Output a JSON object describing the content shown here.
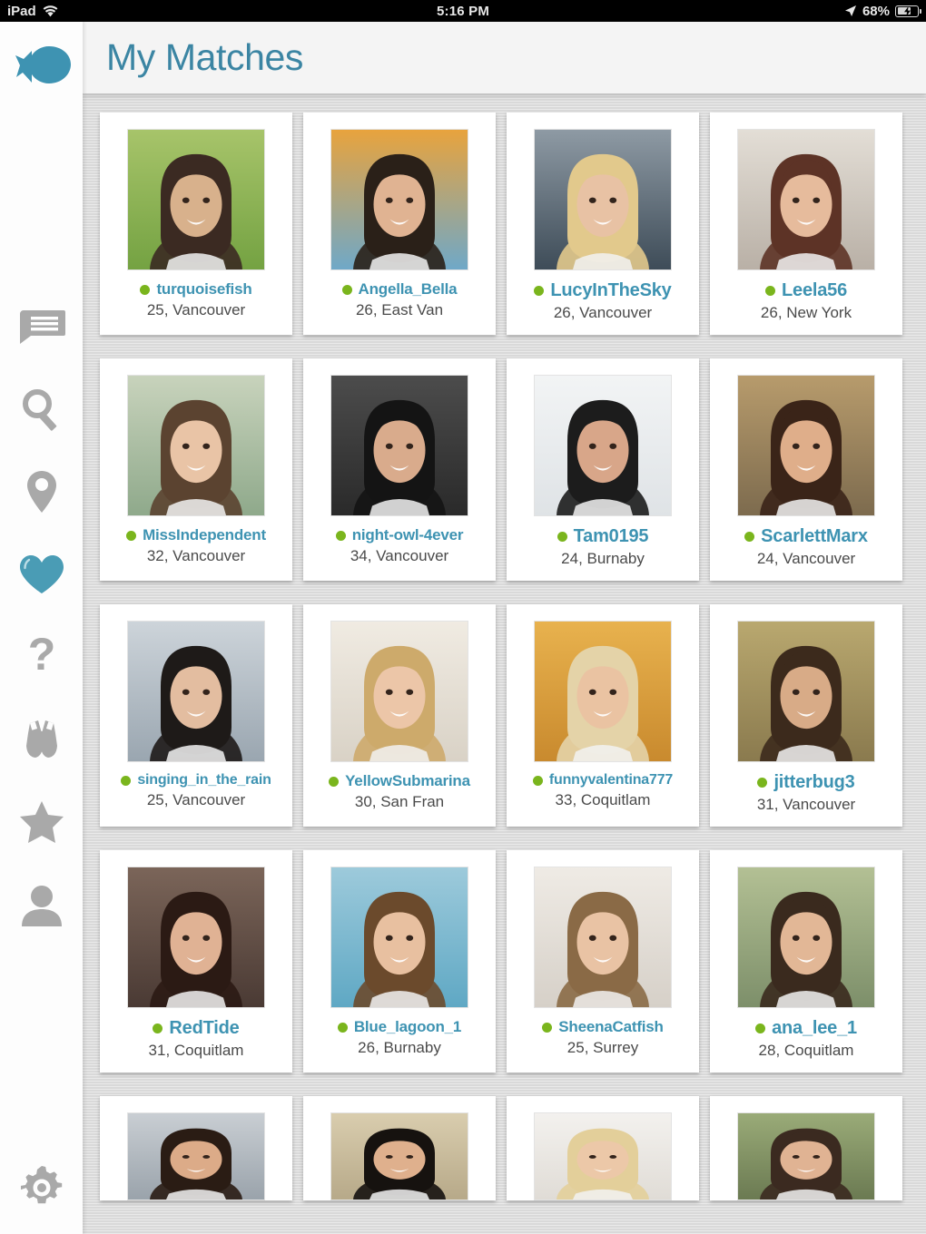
{
  "statusbar": {
    "device": "iPad",
    "wifi_icon": "wifi-icon",
    "time": "5:16 PM",
    "location_icon": "location-arrow-icon",
    "battery_percent": "68%",
    "battery_icon": "battery-charging-icon"
  },
  "brand": {
    "logo_icon": "fish-logo-icon",
    "teal": "#3e93b2",
    "green": "#7ab51d",
    "header_bg": "#f4f4f4"
  },
  "header": {
    "title": "My Matches"
  },
  "sidebar": {
    "items": [
      {
        "name": "messages",
        "icon": "message-bubble-icon",
        "active": false
      },
      {
        "name": "search",
        "icon": "search-icon",
        "active": false
      },
      {
        "name": "nearby",
        "icon": "location-pin-icon",
        "active": false
      },
      {
        "name": "matches",
        "icon": "heart-icon",
        "active": true
      },
      {
        "name": "help",
        "icon": "question-mark-icon",
        "active": false
      },
      {
        "name": "viewed",
        "icon": "binoculars-icon",
        "active": false
      },
      {
        "name": "favourites",
        "icon": "star-icon",
        "active": false
      },
      {
        "name": "profile",
        "icon": "person-icon",
        "active": false
      }
    ],
    "settings": {
      "name": "settings",
      "icon": "gear-icon"
    }
  },
  "matches": [
    {
      "username": "turquoisefish",
      "meta": "25, Vancouver",
      "online": true,
      "photo": "p1"
    },
    {
      "username": "Angella_Bella",
      "meta": "26, East Van",
      "online": true,
      "photo": "p2"
    },
    {
      "username": "LucyInTheSky",
      "meta": "26, Vancouver",
      "online": true,
      "photo": "p3"
    },
    {
      "username": "Leela56",
      "meta": "26, New York",
      "online": true,
      "photo": "p4"
    },
    {
      "username": "MissIndependent",
      "meta": "32, Vancouver",
      "online": true,
      "photo": "p5"
    },
    {
      "username": "night-owl-4ever",
      "meta": "34, Vancouver",
      "online": true,
      "photo": "p6"
    },
    {
      "username": "Tam0195",
      "meta": "24, Burnaby",
      "online": true,
      "photo": "p7"
    },
    {
      "username": "ScarlettMarx",
      "meta": "24, Vancouver",
      "online": true,
      "photo": "p8"
    },
    {
      "username": "singing_in_the_rain",
      "meta": "25, Vancouver",
      "online": true,
      "photo": "p9"
    },
    {
      "username": "YellowSubmarina",
      "meta": "30, San Fran",
      "online": true,
      "photo": "p10"
    },
    {
      "username": "funnyvalentina777",
      "meta": "33, Coquitlam",
      "online": true,
      "photo": "p11"
    },
    {
      "username": "jitterbug3",
      "meta": "31, Vancouver",
      "online": true,
      "photo": "p12"
    },
    {
      "username": "RedTide",
      "meta": "31, Coquitlam",
      "online": true,
      "photo": "p13"
    },
    {
      "username": "Blue_lagoon_1",
      "meta": "26, Burnaby",
      "online": true,
      "photo": "p14"
    },
    {
      "username": "SheenaCatfish",
      "meta": "25, Surrey",
      "online": true,
      "photo": "p15"
    },
    {
      "username": "ana_lee_1",
      "meta": "28, Coquitlam",
      "online": true,
      "photo": "p16"
    },
    {
      "username": "",
      "meta": "",
      "online": false,
      "photo": "p17",
      "partial": true
    },
    {
      "username": "",
      "meta": "",
      "online": false,
      "photo": "p18",
      "partial": true
    },
    {
      "username": "",
      "meta": "",
      "online": false,
      "photo": "p19",
      "partial": true
    },
    {
      "username": "",
      "meta": "",
      "online": false,
      "photo": "p20",
      "partial": true
    }
  ]
}
